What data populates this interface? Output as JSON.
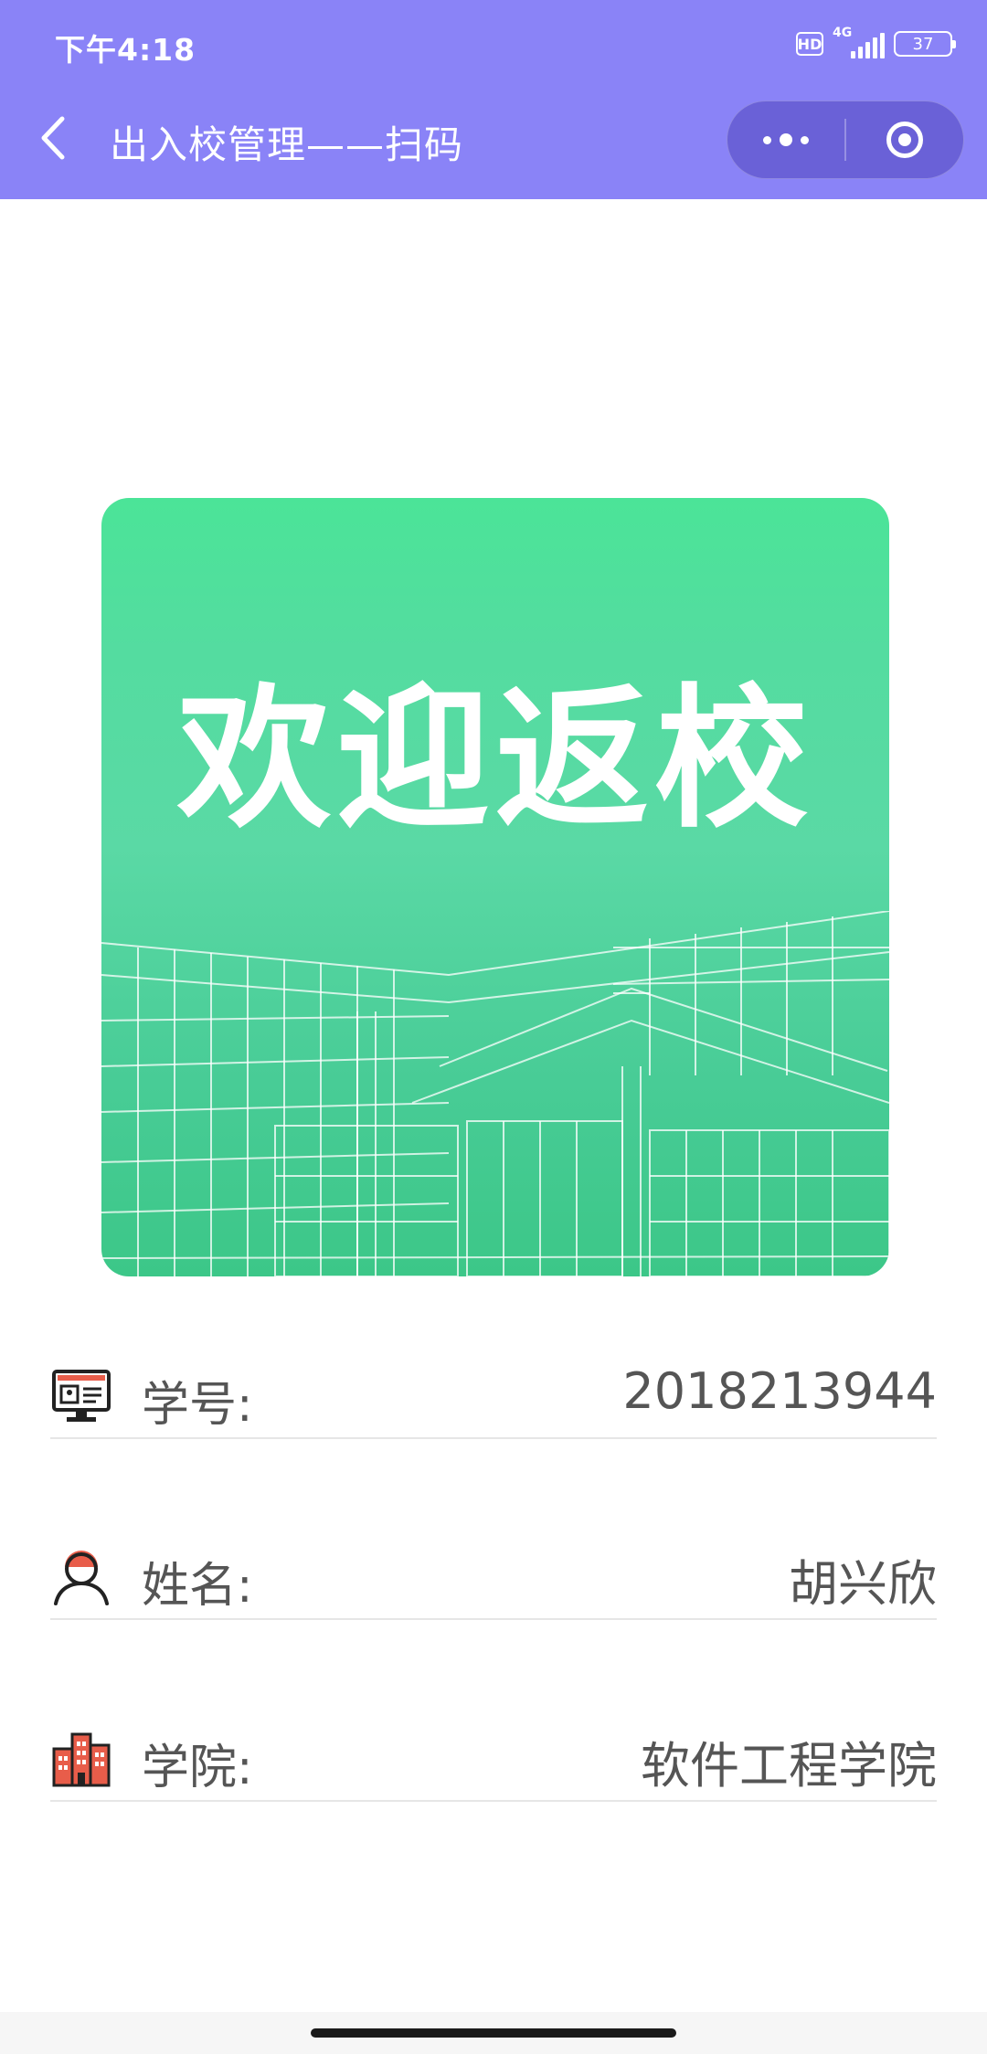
{
  "status_bar": {
    "time": "下午4:18",
    "hd": "HD",
    "network": "4G",
    "battery": "37"
  },
  "nav": {
    "back_icon": "chevron-left-icon",
    "title": "出入校管理——扫码",
    "more_icon": "more-dots-icon",
    "close_icon": "target-circle-icon"
  },
  "banner": {
    "text": "欢迎返校",
    "background_colors": [
      "#4be498",
      "#3cc788"
    ]
  },
  "info": [
    {
      "icon": "id-card-computer-icon",
      "label": "学号:",
      "value": "2018213944"
    },
    {
      "icon": "person-avatar-icon",
      "label": "姓名:",
      "value": "胡兴欣"
    },
    {
      "icon": "buildings-icon",
      "label": "学院:",
      "value": "软件工程学院"
    }
  ],
  "colors": {
    "nav_bar": "#8a83f7",
    "accent_red": "#e85d4a"
  }
}
